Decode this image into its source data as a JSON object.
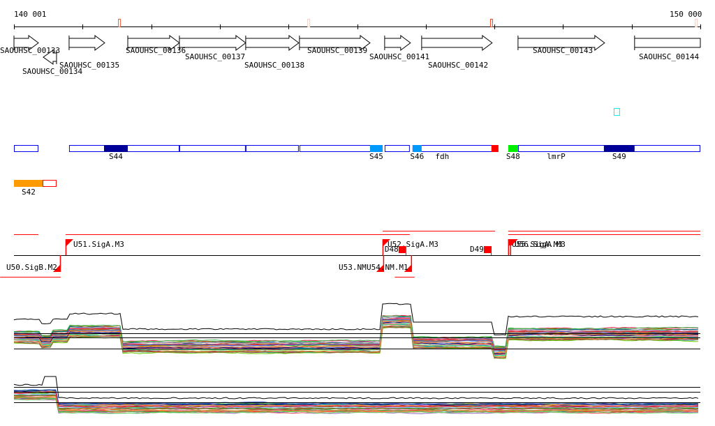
{
  "ruler": {
    "start_label": "140 001",
    "end_label": "150 000",
    "start": 140001,
    "end": 150000,
    "marks": [
      {
        "pos": 141538,
        "color": "#e8603c"
      },
      {
        "pos": 144295,
        "color": "#f5d0c0"
      },
      {
        "pos": 146958,
        "color": "#ff4020"
      },
      {
        "pos": 149940,
        "color": "#f5d0c0"
      }
    ]
  },
  "genes": [
    {
      "name": "SAOUHSC_00133",
      "start": 140001,
      "end": 140357,
      "strand": "+"
    },
    {
      "name": "SAOUHSC_00134",
      "start": 140428,
      "end": 140621,
      "strand": "-"
    },
    {
      "name": "SAOUHSC_00135",
      "start": 140804,
      "end": 141323,
      "strand": "+"
    },
    {
      "name": "SAOUHSC_00136",
      "start": 141659,
      "end": 142411,
      "strand": "+"
    },
    {
      "name": "SAOUHSC_00137",
      "start": 142411,
      "end": 143377,
      "strand": "+"
    },
    {
      "name": "SAOUHSC_00138",
      "start": 143377,
      "end": 144150,
      "strand": "+"
    },
    {
      "name": "SAOUHSC_00139",
      "start": 144160,
      "end": 145188,
      "strand": "+"
    },
    {
      "name": "SAOUHSC_00141",
      "start": 145401,
      "end": 145777,
      "strand": "+"
    },
    {
      "name": "SAOUHSC_00142",
      "start": 145940,
      "end": 146967,
      "strand": "+"
    },
    {
      "name": "SAOUHSC_00143",
      "start": 147344,
      "end": 148605,
      "strand": "+"
    },
    {
      "name": "SAOUHSC_00144",
      "start": 149042,
      "end": 150000,
      "strand": "none"
    }
  ],
  "segments": {
    "outline_color": "#0000ee",
    "boxes": [
      [
        140001,
        140357
      ],
      [
        140804,
        142411
      ],
      [
        142411,
        143377
      ],
      [
        143377,
        144150
      ],
      [
        144160,
        145371
      ],
      [
        145401,
        145767
      ],
      [
        145808,
        146967
      ],
      [
        147344,
        150000
      ]
    ],
    "filled": [
      {
        "label": "S44",
        "start": 141313,
        "end": 141659,
        "color": "#000099"
      },
      {
        "label": "S45",
        "start": 145188,
        "end": 145371,
        "color": "#0099ff"
      },
      {
        "label": "S46",
        "start": 145808,
        "end": 145940,
        "color": "#0099ff"
      },
      {
        "label": "",
        "start": 146958,
        "end": 147059,
        "color": "#ff0000"
      },
      {
        "label": "S48",
        "start": 147201,
        "end": 147344,
        "color": "#00ee00"
      },
      {
        "label": "S49",
        "start": 148595,
        "end": 149042,
        "color": "#000099"
      }
    ],
    "names": [
      {
        "label": "fdh",
        "pos": 146240
      },
      {
        "label": "lmrP",
        "pos": 147900
      }
    ],
    "cyan_marker": {
      "start": 148738,
      "end": 148829,
      "color": "#00eeee"
    },
    "s42": {
      "label": "S42",
      "start": 140001,
      "end": 140418,
      "color": "#ff9900",
      "tail_end": 140621,
      "tail_color": "#ff0000"
    }
  },
  "transcripts": {
    "color": "#ff0000",
    "lines_top": [
      [
        140001,
        140357,
        0
      ],
      [
        140753,
        145371,
        0
      ],
      [
        145371,
        147009,
        1
      ],
      [
        145371,
        145767,
        0
      ],
      [
        147201,
        150000,
        1
      ],
      [
        147201,
        150000,
        0
      ]
    ],
    "lines_bottom": [
      [
        139800,
        140682
      ],
      [
        145549,
        145838
      ]
    ],
    "promoters": [
      {
        "label": "U51.SigA.M3",
        "pos": 140753,
        "strand": "+"
      },
      {
        "label": "U50.SigB.M2",
        "pos": 140682,
        "strand": "-"
      },
      {
        "label": "U52.SigA.M3",
        "pos": 145371,
        "strand": "+"
      },
      {
        "label": "U53.NM",
        "pos": 145391,
        "strand": "-"
      },
      {
        "label": "U54.NM.M1",
        "pos": 145797,
        "strand": "-"
      },
      {
        "label": "U55.SigA.M3",
        "pos": 147201,
        "strand": "+"
      },
      {
        "label": "U56.SigA.M3",
        "pos": 147231,
        "strand": "+"
      }
    ],
    "terminators": [
      {
        "label": "D48",
        "pos": 145625
      },
      {
        "label": "D49",
        "pos": 146867
      }
    ]
  },
  "expression_panels": 2
}
